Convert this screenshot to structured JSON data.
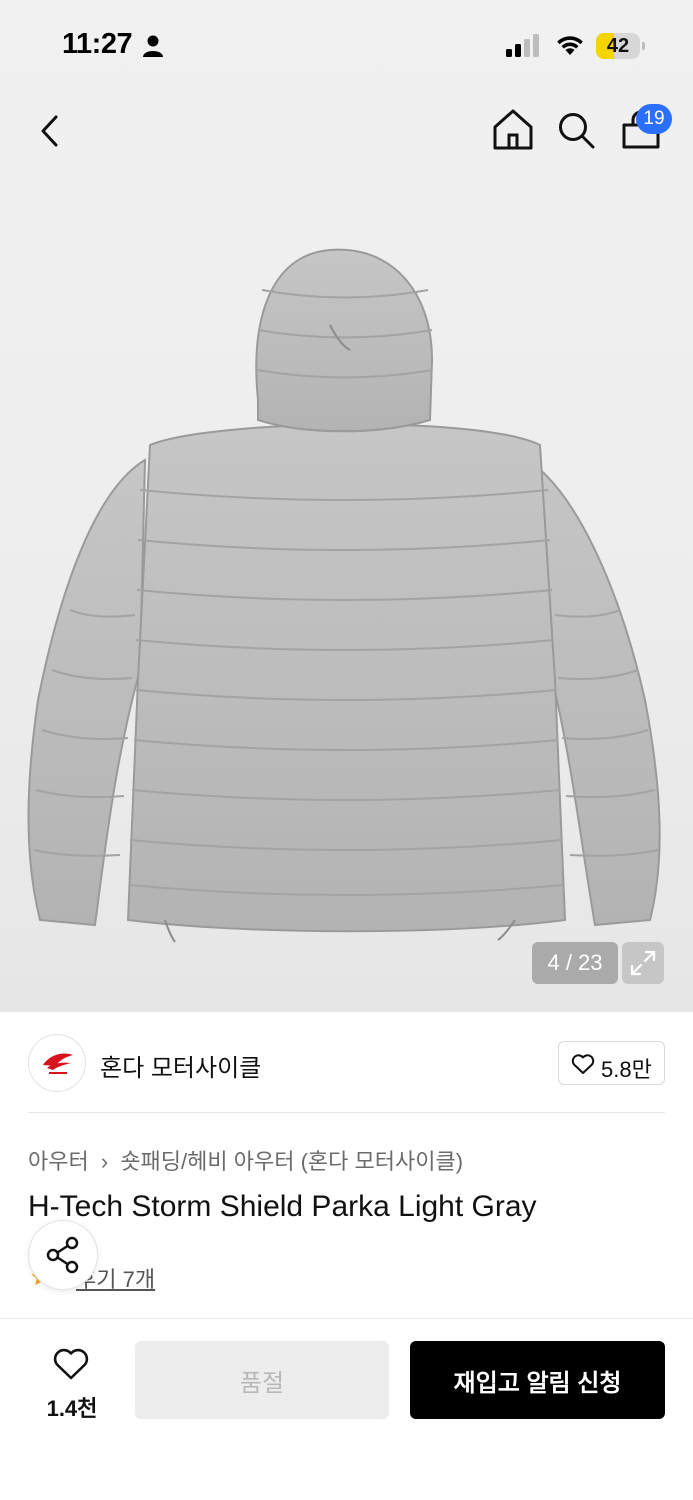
{
  "status_bar": {
    "time": "11:27",
    "battery_level": "42",
    "battery_fraction": 0.42,
    "battery_color": "#f6d400"
  },
  "nav": {
    "back_icon": "chevron-left-icon",
    "home_icon": "home-icon",
    "search_icon": "search-icon",
    "cart_icon": "shopping-bag-icon",
    "cart_count": "19",
    "badge_color": "#2b6fff"
  },
  "gallery": {
    "counter": "4 / 23",
    "expand_icon": "expand-icon"
  },
  "brand": {
    "name": "혼다 모터사이클",
    "like_count": "5.8만",
    "logo_icon": "honda-wing-logo"
  },
  "breadcrumb": {
    "items": [
      "아우터",
      "숏패딩/헤비 아우터 (혼다 모터사이클)"
    ]
  },
  "product": {
    "title": "H-Tech Storm Shield Parka Light Gray",
    "review_label": "후기 7개",
    "star_color": "#f5a623"
  },
  "bottom_bar": {
    "wish_count": "1.4천",
    "soldout_label": "품절",
    "restock_label": "재입고 알림 신청"
  }
}
